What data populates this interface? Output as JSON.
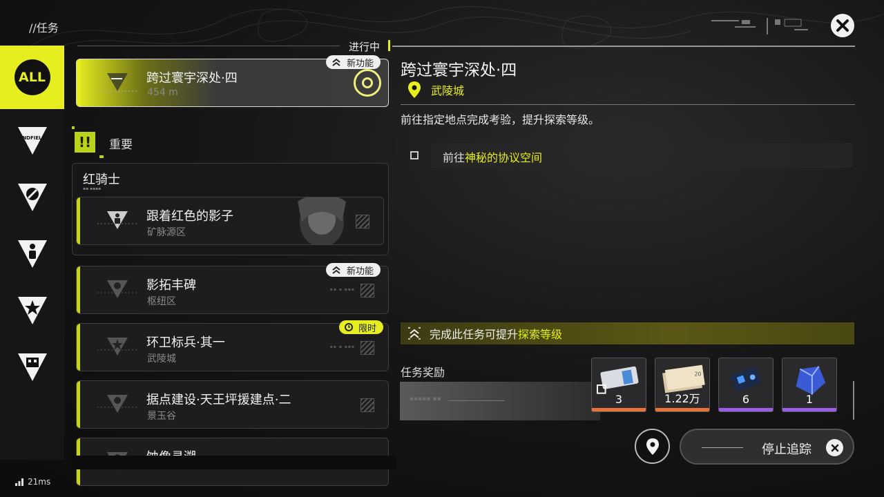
{
  "breadcrumb": "//任务",
  "rail": {
    "items": [
      {
        "name": "all",
        "label": "ALL",
        "active": true
      },
      {
        "name": "endfield",
        "label": "ENDFIELD"
      },
      {
        "name": "type-2"
      },
      {
        "name": "type-3"
      },
      {
        "name": "type-4"
      },
      {
        "name": "type-5"
      }
    ]
  },
  "list": {
    "status_label": "进行中",
    "active_quest": {
      "title": "跨过寰宇深处·四",
      "sub": "454 m",
      "badge": "新功能"
    },
    "important_label": "重要",
    "important_icon": "!!",
    "group": {
      "title": "红骑士",
      "quest": {
        "title": "跟着红色的影子",
        "sub": "矿脉源区"
      }
    },
    "quests": [
      {
        "title": "影拓丰碑",
        "sub": "枢纽区",
        "badge": "新功能"
      },
      {
        "title": "环卫标兵·其一",
        "sub": "武陵城",
        "badge": "限时"
      },
      {
        "title": "据点建设·天王坪援建点·二",
        "sub": "景玉谷"
      },
      {
        "title": "蚀像寻溯",
        "sub": ""
      }
    ]
  },
  "detail": {
    "title": "跨过寰宇深处·四",
    "location": "武陵城",
    "description": "前往指定地点完成考验，提升探索等级。",
    "objective_prefix": "前往",
    "objective_highlight": "神秘的协议空间",
    "explore_prefix": "完成此任务可提升",
    "explore_highlight": "探索等级",
    "reward_label": "任务奖励",
    "rewards": [
      {
        "qty": "3",
        "rarity_color": "#e8733a"
      },
      {
        "qty": "1.22万",
        "rarity_color": "#e8733a"
      },
      {
        "qty": "6",
        "rarity_color": "#9b5de5"
      },
      {
        "qty": "1",
        "rarity_color": "#9b5de5"
      }
    ],
    "stop_label": "停止追踪"
  },
  "status": {
    "ping": "21ms"
  },
  "colors": {
    "accent": "#e6ee1f",
    "panel": "#1e1e1f"
  }
}
